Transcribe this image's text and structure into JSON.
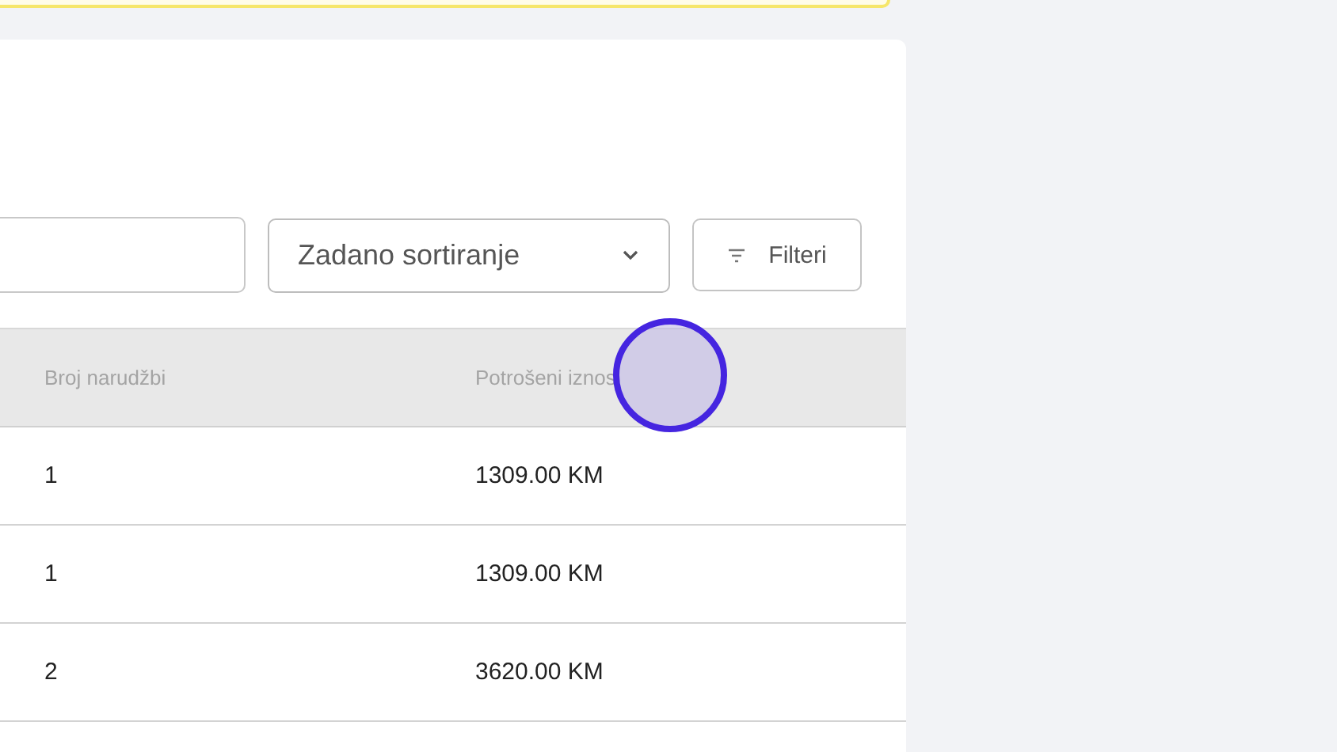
{
  "toolbar": {
    "sort_select": {
      "value": "Zadano sortiranje"
    },
    "filter_button": {
      "label": "Filteri"
    }
  },
  "table": {
    "columns": [
      "Broj narudžbi",
      "Potrošeni iznos"
    ],
    "rows": [
      [
        "1",
        "1309.00 KM"
      ],
      [
        "1",
        "1309.00 KM"
      ],
      [
        "2",
        "3620.00 KM"
      ]
    ]
  }
}
